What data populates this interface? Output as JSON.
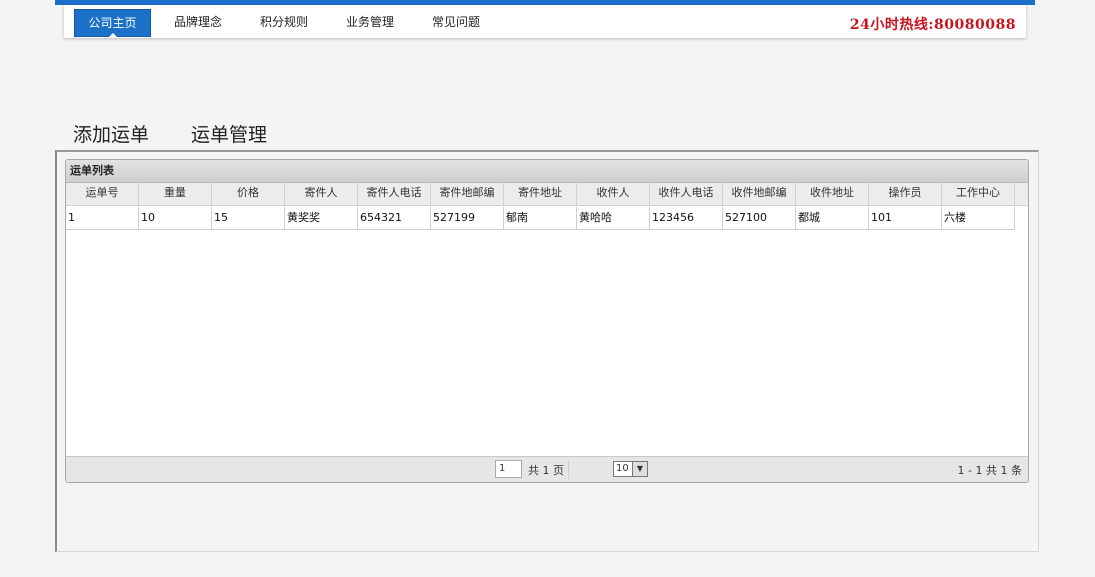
{
  "nav": {
    "items": [
      "公司主页",
      "品牌理念",
      "积分规则",
      "业务管理",
      "常见问题"
    ],
    "active_index": 0,
    "hotline": "24小时热线:80080088"
  },
  "tabs": [
    "添加运单",
    "运单管理"
  ],
  "grid": {
    "title": "运单列表",
    "columns": [
      "运单号",
      "重量",
      "价格",
      "寄件人",
      "寄件人电话",
      "寄件地邮编",
      "寄件地址",
      "收件人",
      "收件人电话",
      "收件地邮编",
      "收件地址",
      "操作员",
      "工作中心"
    ],
    "rows": [
      [
        "1",
        "10",
        "15",
        "黄奖奖",
        "654321",
        "527199",
        "郁南",
        "黄哈哈",
        "123456",
        "527100",
        "都城",
        "101",
        "六楼"
      ]
    ]
  },
  "pager": {
    "page_value": "1",
    "total_pages_text": "共 1 页",
    "page_size": "10",
    "info": "1 - 1   共 1 条"
  },
  "colors": {
    "accent": "#1b72c8",
    "hotline": "#c8141e"
  }
}
